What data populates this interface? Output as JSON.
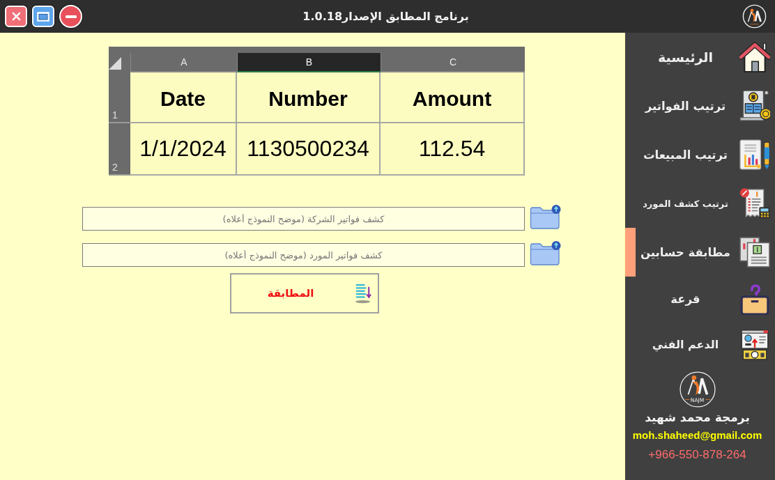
{
  "window": {
    "title": "برنامج المطابق الإصدار1.0.18"
  },
  "sheet": {
    "column_headers": [
      {
        "label": "C",
        "selected": false
      },
      {
        "label": "B",
        "selected": true
      },
      {
        "label": "A",
        "selected": false
      }
    ],
    "rows": [
      {
        "row_header": "1",
        "kind": "header",
        "cells": [
          "Amount",
          "Number",
          "Date"
        ]
      },
      {
        "row_header": "2",
        "kind": "data",
        "cells": [
          "112.54",
          "1130500234",
          "1/1/2024"
        ]
      }
    ]
  },
  "file_fields": [
    {
      "placeholder": "كشف فواتير الشركة (موضح النموذج أعلاه)"
    },
    {
      "placeholder": "كشف فواتير المورد (موضح النموذج أعلاه)"
    }
  ],
  "match_button": {
    "label": "المطابقة"
  },
  "sidebar": {
    "items": [
      {
        "label": "الرئيسية",
        "selected": false
      },
      {
        "label": "ترتيب الفواتير",
        "selected": false
      },
      {
        "label": "ترتيب المبيعات",
        "selected": false
      },
      {
        "label": "ترتيب كشف المورد",
        "selected": false
      },
      {
        "label": "مطابقة حسابين",
        "selected": true
      },
      {
        "label": "قرعة",
        "selected": false
      },
      {
        "label": "الدعم الفني",
        "selected": false
      }
    ],
    "author": {
      "logo_caption": "NAJM",
      "name": "برمجة محمد شهيد",
      "email": "moh.shaheed@gmail.com",
      "phone": "+966-550-878-264"
    }
  }
}
